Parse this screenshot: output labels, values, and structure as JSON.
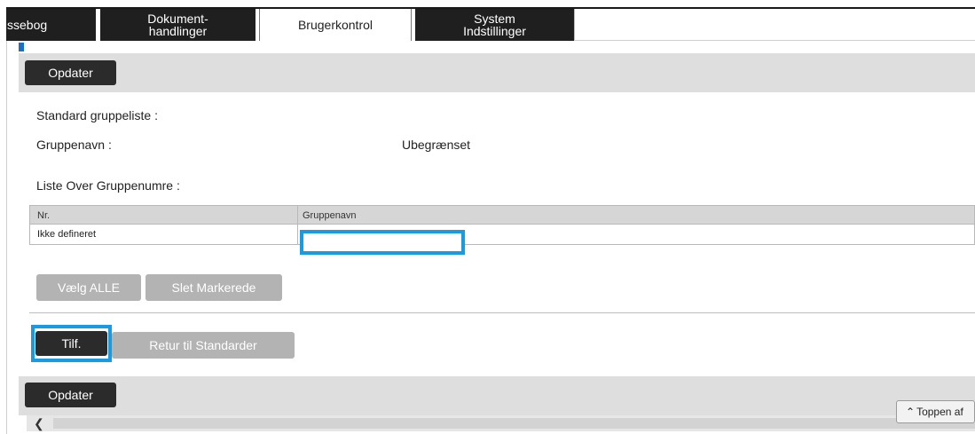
{
  "tabs": [
    {
      "label": "ssebog"
    },
    {
      "label": "Dokument-\nhandlinger"
    },
    {
      "label": "Brugerkontrol"
    },
    {
      "label": "System\nIndstillinger"
    }
  ],
  "toolbar": {
    "update_label": "Opdater"
  },
  "content": {
    "standard_group_list_label": "Standard gruppeliste :",
    "group_name_label": "Gruppenavn :",
    "group_name_value": "Ubegrænset",
    "group_number_list_label": "Liste Over Gruppenumre :"
  },
  "table": {
    "headers": [
      "Nr.",
      "Gruppenavn"
    ],
    "rows": [
      {
        "nr": "Ikke defineret",
        "name": ""
      }
    ]
  },
  "actions": {
    "select_all_label": "Vælg ALLE",
    "delete_selected_label": "Slet Markerede",
    "add_label": "Tilf.",
    "reset_label": "Retur til Standarder"
  },
  "footer": {
    "update_label": "Opdater",
    "back_to_top_label": "Toppen af"
  },
  "colors": {
    "accent": "#1a9be0",
    "dark_button": "#2b2b2b",
    "disabled_button": "#b3b3b3"
  }
}
